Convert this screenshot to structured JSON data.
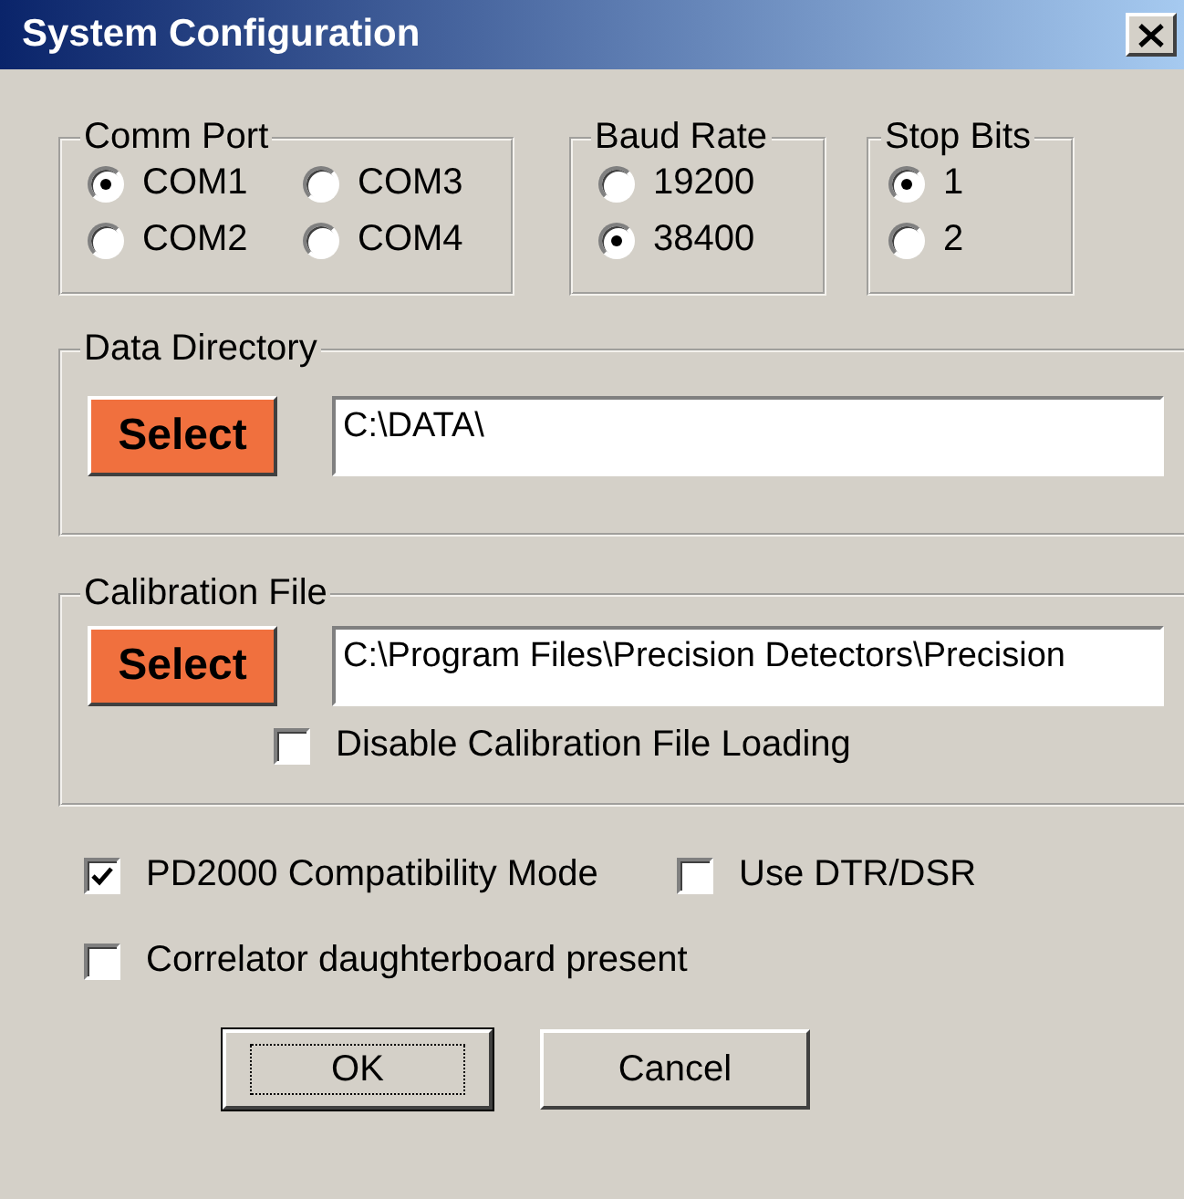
{
  "window": {
    "title": "System Configuration"
  },
  "comm_port": {
    "label": "Comm Port",
    "options": [
      {
        "label": "COM1",
        "selected": true
      },
      {
        "label": "COM3",
        "selected": false
      },
      {
        "label": "COM2",
        "selected": false
      },
      {
        "label": "COM4",
        "selected": false
      }
    ]
  },
  "baud_rate": {
    "label": "Baud Rate",
    "options": [
      {
        "label": "19200",
        "selected": false
      },
      {
        "label": "38400",
        "selected": true
      }
    ]
  },
  "stop_bits": {
    "label": "Stop Bits",
    "options": [
      {
        "label": "1",
        "selected": true
      },
      {
        "label": "2",
        "selected": false
      }
    ]
  },
  "data_directory": {
    "label": "Data Directory",
    "button": "Select",
    "value": "C:\\DATA\\"
  },
  "calibration_file": {
    "label": "Calibration File",
    "button": "Select",
    "value": "C:\\Program Files\\Precision Detectors\\Precision",
    "disable_loading": {
      "label": "Disable Calibration File Loading",
      "checked": false
    }
  },
  "options": [
    {
      "label": "PD2000 Compatibility Mode",
      "checked": true
    },
    {
      "label": "Use DTR/DSR",
      "checked": false
    },
    {
      "label": "Correlator daughterboard present",
      "checked": false
    }
  ],
  "buttons": [
    {
      "label": "OK",
      "focused": true
    },
    {
      "label": "Cancel",
      "focused": false
    }
  ]
}
